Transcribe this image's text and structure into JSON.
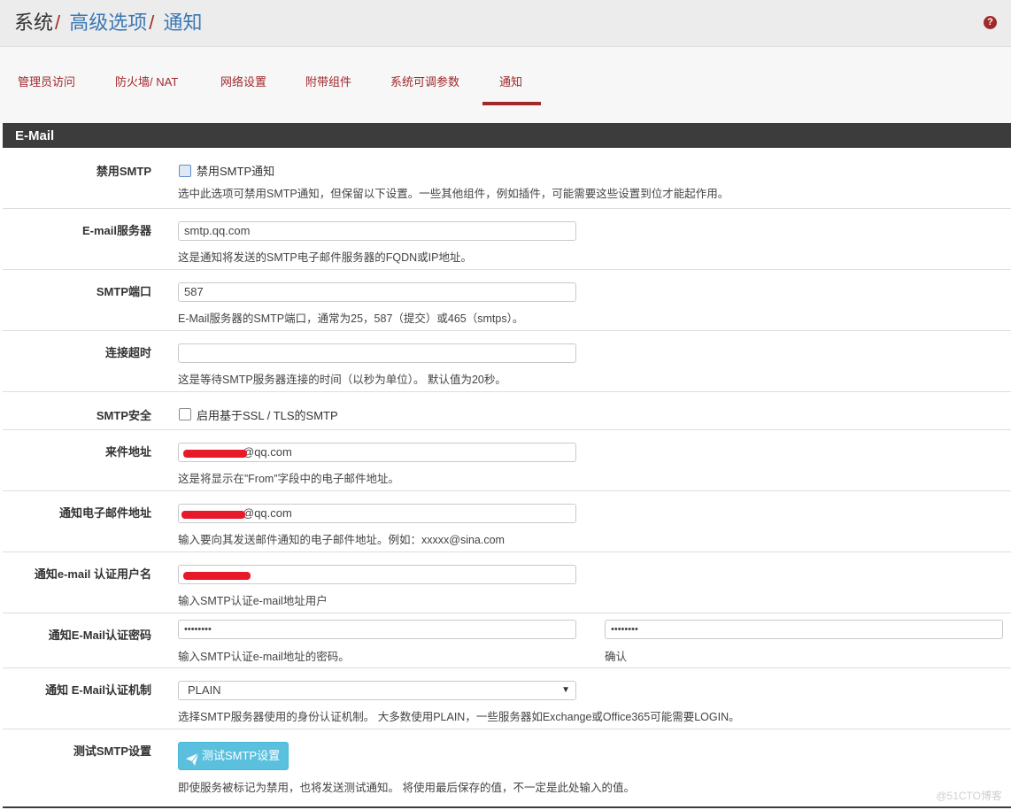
{
  "header": {
    "breadcrumb": [
      "系统",
      "高级选项",
      "通知"
    ],
    "help_icon": "?"
  },
  "tabs": [
    {
      "label": "管理员访问",
      "active": false
    },
    {
      "label": "防火墙/ NAT",
      "active": false
    },
    {
      "label": "网络设置",
      "active": false
    },
    {
      "label": "附带组件",
      "active": false
    },
    {
      "label": "系统可调参数",
      "active": false
    },
    {
      "label": "通知",
      "active": true
    }
  ],
  "section": {
    "title": "E-Mail"
  },
  "fields": {
    "disable_smtp": {
      "label": "禁用SMTP",
      "checkbox_label": "禁用SMTP通知",
      "checked": false,
      "help": "选中此选项可禁用SMTP通知，但保留以下设置。一些其他组件，例如插件，可能需要这些设置到位才能起作用。"
    },
    "email_server": {
      "label": "E-mail服务器",
      "value": "smtp.qq.com",
      "help": "这是通知将发送的SMTP电子邮件服务器的FQDN或IP地址。"
    },
    "smtp_port": {
      "label": "SMTP端口",
      "value": "587",
      "help": "E-Mail服务器的SMTP端口，通常为25，587（提交）或465（smtps）。"
    },
    "timeout": {
      "label": "连接超时",
      "value": "",
      "help": "这是等待SMTP服务器连接的时间（以秒为单位）。 默认值为20秒。"
    },
    "smtp_ssl": {
      "label": "SMTP安全",
      "checkbox_label": "启用基于SSL / TLS的SMTP",
      "checked": false
    },
    "from_address": {
      "label": "来件地址",
      "value": "@qq.com",
      "help": "这是将显示在”From”字段中的电子邮件地址。"
    },
    "notify_address": {
      "label": "通知电子邮件地址",
      "value": "@qq.com",
      "help": "输入要向其发送邮件通知的电子邮件地址。例如：xxxxx@sina.com"
    },
    "auth_user": {
      "label": "通知e-mail 认证用户名",
      "value": "",
      "help": "输入SMTP认证e-mail地址用户"
    },
    "auth_password": {
      "label": "通知E-Mail认证密码",
      "value": "••••••••",
      "help": "输入SMTP认证e-mail地址的密码。",
      "confirm_value": "••••••••",
      "confirm_help": "确认"
    },
    "auth_mechanism": {
      "label": "通知 E-Mail认证机制",
      "value": "PLAIN",
      "help": "选择SMTP服务器使用的身份认证机制。 大多数使用PLAIN，一些服务器如Exchange或Office365可能需要LOGIN。"
    },
    "test_smtp": {
      "label": "测试SMTP设置",
      "button_label": "测试SMTP设置",
      "help": "即使服务被标记为禁用，也将发送测试通知。 将使用最后保存的值，不一定是此处输入的值。"
    }
  },
  "watermark": "@51CTO博客",
  "colors": {
    "accent": "#a0292c",
    "link": "#3a78b5",
    "panel_header": "#3c3c3c",
    "button": "#5bc0de",
    "redaction": "#e8192a"
  }
}
